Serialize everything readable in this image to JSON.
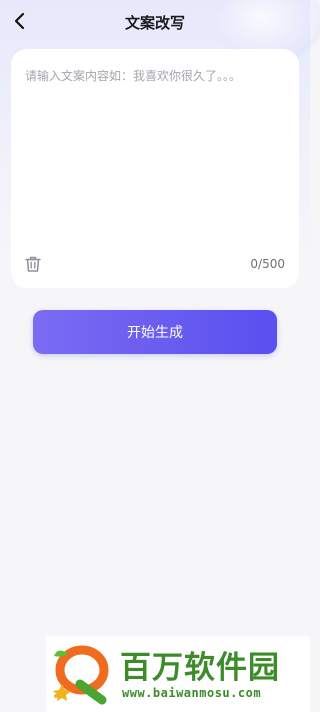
{
  "nav": {
    "title": "文案改写",
    "back_icon": "chevron-left-icon"
  },
  "editor": {
    "placeholder": "请输入文案内容如：我喜欢你很久了。。。",
    "value": "",
    "counter": "0/500",
    "clear_icon": "trash-icon"
  },
  "actions": {
    "generate_label": "开始生成"
  },
  "watermark": {
    "name": "百万软件园",
    "url": "www.baiwanmosu.com"
  },
  "colors": {
    "accent_start": "#7a6cf2",
    "accent_end": "#5a4ff0",
    "watermark_green": "#3c8c2a"
  }
}
